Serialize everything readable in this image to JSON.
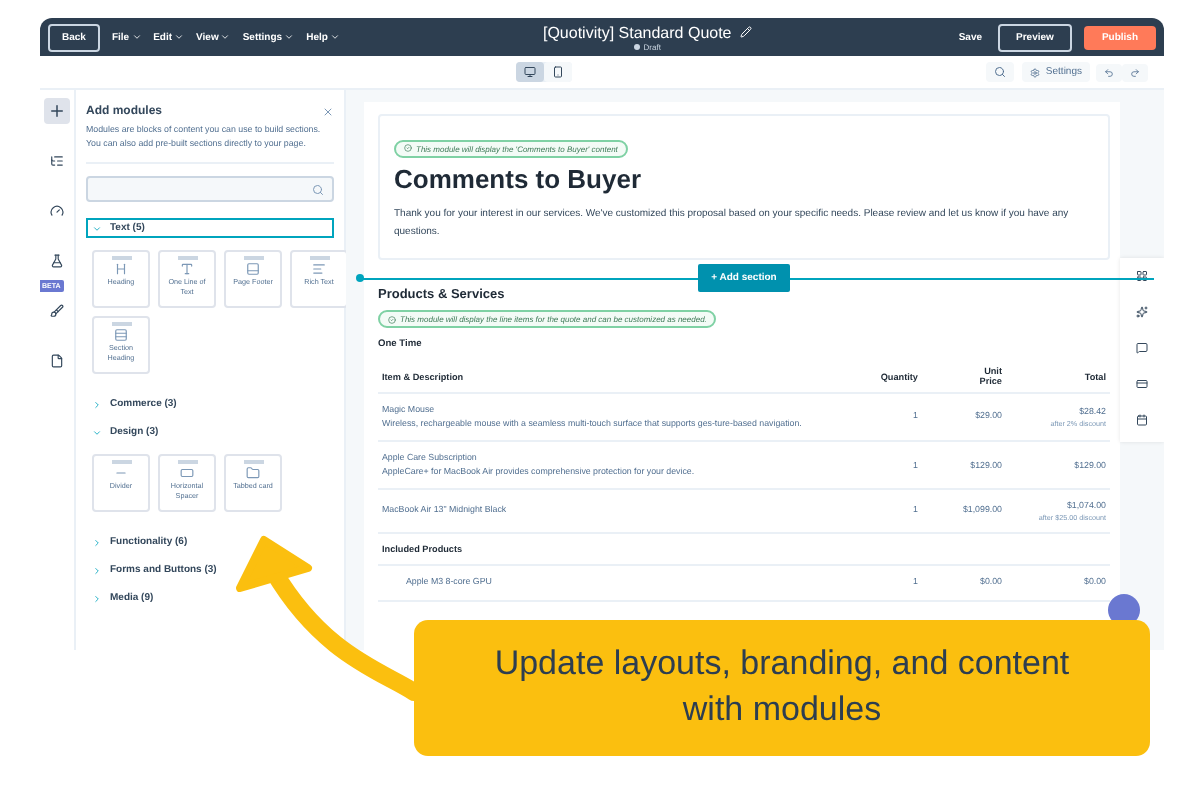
{
  "top_bar": {
    "back": "Back",
    "menus": [
      "File",
      "Edit",
      "View",
      "Settings",
      "Help"
    ],
    "title": "[Quotivity] Standard Quote",
    "status": "Draft",
    "save": "Save",
    "preview": "Preview",
    "publish": "Publish"
  },
  "toolbar": {
    "devices": [
      {
        "kind": "desktop",
        "selected": true
      },
      {
        "kind": "mobile",
        "selected": false
      }
    ],
    "settings": "Settings"
  },
  "rail": [
    {
      "kind": "add",
      "selected": true
    },
    {
      "kind": "layers",
      "selected": false
    },
    {
      "kind": "gauge",
      "selected": false
    },
    {
      "kind": "flask",
      "selected": false
    },
    {
      "kind": "brush",
      "selected": false,
      "badge": "BETA"
    },
    {
      "kind": "page",
      "selected": false
    }
  ],
  "panel": {
    "title": "Add modules",
    "description": "Modules are blocks of content you can use to build sections. You can also add pre-built sections directly to your page.",
    "categories": [
      {
        "label": "Text (5)",
        "expanded": true,
        "selected": true,
        "modules": [
          {
            "label": "Heading",
            "kind": "heading"
          },
          {
            "label": "One Line of Text",
            "kind": "line"
          },
          {
            "label": "Page Footer",
            "kind": "footer"
          },
          {
            "label": "Rich Text",
            "kind": "rich"
          },
          {
            "label": "Section Heading",
            "kind": "section"
          }
        ]
      },
      {
        "label": "Commerce (3)",
        "expanded": false,
        "selected": false
      },
      {
        "label": "Design (3)",
        "expanded": true,
        "selected": false,
        "modules": [
          {
            "label": "Divider",
            "kind": "divider"
          },
          {
            "label": "Horizontal Spacer",
            "kind": "spacer"
          },
          {
            "label": "Tabbed card",
            "kind": "tabs"
          }
        ]
      },
      {
        "label": "Functionality (6)",
        "expanded": false,
        "selected": false
      },
      {
        "label": "Forms and Buttons (3)",
        "expanded": false,
        "selected": false
      },
      {
        "label": "Media (9)",
        "expanded": false,
        "selected": false
      }
    ]
  },
  "comments": {
    "notice": "This module will display the 'Comments to Buyer' content",
    "heading": "Comments to Buyer",
    "body": "Thank you for your interest in our services. We've customized this proposal based on your specific needs. Please review and let us know if you have any questions."
  },
  "add_section": "+ Add section",
  "products": {
    "heading": "Products & Services",
    "notice": "This module will display the line items for the quote and can be customized as needed.",
    "group": "One Time",
    "columns": [
      "Item & Description",
      "Quantity",
      "Unit Price",
      "Total"
    ],
    "rows": [
      {
        "name": "Magic Mouse",
        "description": "Wireless, rechargeable mouse with a seamless multi-touch surface that supports ges-ture-based navigation.",
        "quantity": "1",
        "unit_price": "$29.00",
        "total": "$28.42",
        "discount": "after 2% discount"
      },
      {
        "name": "Apple Care Subscription",
        "description": "AppleCare+ for MacBook Air provides comprehensive protection for your device.",
        "quantity": "1",
        "unit_price": "$129.00",
        "total": "$129.00"
      },
      {
        "name": "MacBook Air 13\" Midnight Black",
        "quantity": "1",
        "unit_price": "$1,099.00",
        "total": "$1,074.00",
        "discount": "after $25.00 discount"
      }
    ],
    "included_heading": "Included Products",
    "included": [
      {
        "name": "Apple M3 8-core GPU",
        "quantity": "1",
        "unit_price": "$0.00",
        "total": "$0.00"
      }
    ]
  },
  "right_rail": [
    {
      "kind": "grid"
    },
    {
      "kind": "sparkle"
    },
    {
      "kind": "chat"
    },
    {
      "kind": "card"
    },
    {
      "kind": "calendar"
    }
  ],
  "callout": "Update layouts, branding, and content with modules"
}
